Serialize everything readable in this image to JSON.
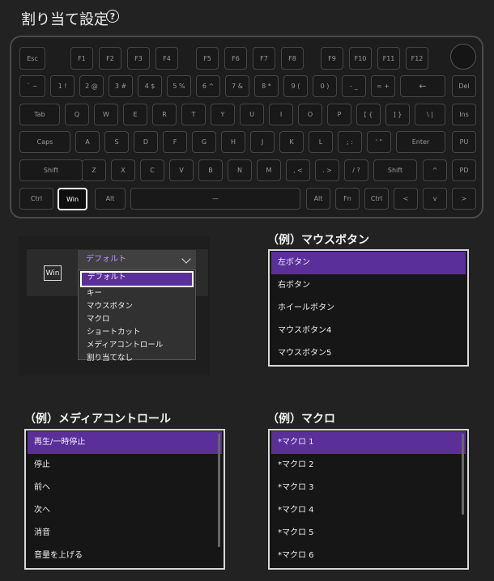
{
  "title": "割り当て設定",
  "help_glyph": "?",
  "keyboard": {
    "row1": [
      "Esc",
      "F1",
      "F2",
      "F3",
      "F4",
      "F5",
      "F6",
      "F7",
      "F8",
      "F9",
      "F10",
      "F11",
      "F12"
    ],
    "row2": [
      "` ~",
      "1 !",
      "2 @",
      "3 #",
      "4 $",
      "5 %",
      "6 ^",
      "7 &",
      "8 *",
      "9 (",
      "0 )",
      "- _",
      "= +",
      "←",
      "Del"
    ],
    "row3": [
      "Tab",
      "Q",
      "W",
      "E",
      "R",
      "T",
      "Y",
      "U",
      "I",
      "O",
      "P",
      "[ {",
      "] }",
      "\\ |",
      "Ins"
    ],
    "row4": [
      "Caps",
      "A",
      "S",
      "D",
      "F",
      "G",
      "H",
      "J",
      "K",
      "L",
      "; :",
      "' \"",
      "Enter",
      "PU"
    ],
    "row5": [
      "Shift",
      "Z",
      "X",
      "C",
      "V",
      "B",
      "N",
      "M",
      ", <",
      ". >",
      "/ ?",
      "Shift",
      "^",
      "PD"
    ],
    "row6": [
      "Ctrl",
      "Win",
      "Alt",
      "—",
      "Alt",
      "Fn",
      "Ctrl",
      "<",
      "v",
      ">"
    ]
  },
  "mapper": {
    "key_label": "Win",
    "selected": "デフォルト",
    "options": [
      "デフォルト",
      "キー",
      "マウスボタン",
      "マクロ",
      "ショートカット",
      "メディアコントロール",
      "割り当てなし"
    ]
  },
  "mouse_example": {
    "title": "（例）マウスボタン",
    "items": [
      "左ボタン",
      "右ボタン",
      "ホイールボタン",
      "マウスボタン4",
      "マウスボタン5"
    ]
  },
  "media_example": {
    "title": "（例）メディアコントロール",
    "items": [
      "再生/一時停止",
      "停止",
      "前へ",
      "次へ",
      "消音",
      "音量を上げる"
    ]
  },
  "macro_example": {
    "title": "（例）マクロ",
    "items": [
      "*マクロ 1",
      "*マクロ 2",
      "*マクロ 3",
      "*マクロ 4",
      "*マクロ 5",
      "*マクロ 6"
    ]
  },
  "colors": {
    "accent": "#5b2f9a",
    "accent_text": "#b893ff",
    "background": "#222222"
  }
}
